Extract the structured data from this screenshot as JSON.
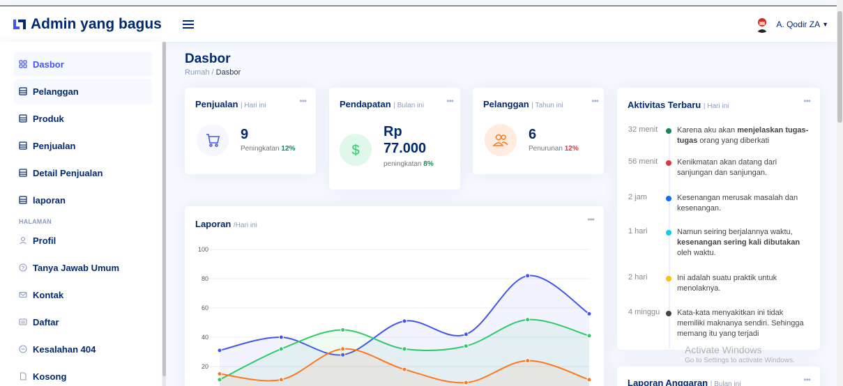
{
  "brand": {
    "title": "Admin yang bagus"
  },
  "user": {
    "name": "A. Qodir ZA"
  },
  "sidebar": {
    "items": [
      {
        "label": "Dasbor",
        "icon": "grid-icon"
      },
      {
        "label": "Pelanggan",
        "icon": "layout-icon"
      },
      {
        "label": "Produk",
        "icon": "layout-icon"
      },
      {
        "label": "Penjualan",
        "icon": "layout-icon"
      },
      {
        "label": "Detail Penjualan",
        "icon": "layout-icon"
      },
      {
        "label": "laporan",
        "icon": "layout-icon"
      }
    ],
    "heading": "HALAMAN",
    "pages": [
      {
        "label": "Profil",
        "icon": "person-icon"
      },
      {
        "label": "Tanya Jawab Umum",
        "icon": "question-circle-icon"
      },
      {
        "label": "Kontak",
        "icon": "envelope-icon"
      },
      {
        "label": "Daftar",
        "icon": "card-list-icon"
      },
      {
        "label": "Kesalahan 404",
        "icon": "dash-circle-icon"
      },
      {
        "label": "Kosong",
        "icon": "file-icon"
      }
    ]
  },
  "page": {
    "title": "Dasbor",
    "breadcrumb": [
      "Rumah",
      "Dasbor"
    ]
  },
  "cards": {
    "sales": {
      "title": "Penjualan",
      "filter": "| Hari ini",
      "value": "9",
      "pct": "12%",
      "note": "Peningkatan",
      "icon": "cart-icon"
    },
    "revenue": {
      "title": "Pendapatan",
      "filter": "| Bulan ini",
      "value_line1": "Rp",
      "value_line2": "77.000",
      "pct": "8%",
      "note": "peningkatan",
      "icon": "dollar-icon"
    },
    "customers": {
      "title": "Pelanggan",
      "filter": "| Tahun ini",
      "value": "6",
      "pct": "12%",
      "note": "Penurunan",
      "icon": "people-icon"
    }
  },
  "report": {
    "title": "Laporan",
    "filter": "/Hari ini"
  },
  "chart_data": {
    "type": "area",
    "title": "Laporan",
    "ylim": [
      0,
      100
    ],
    "y_ticks": [
      20,
      40,
      60,
      80,
      100
    ],
    "grid": true,
    "series": [
      {
        "color": "#4154f1",
        "values": [
          31,
          40,
          28,
          51,
          42,
          82,
          56
        ]
      },
      {
        "color": "#2eca6a",
        "values": [
          11,
          32,
          45,
          32,
          34,
          52,
          41
        ]
      },
      {
        "color": "#ff771d",
        "values": [
          15,
          11,
          32,
          18,
          9,
          24,
          11
        ]
      }
    ]
  },
  "activity": {
    "title": "Aktivitas Terbaru",
    "filter": "| Hari ini",
    "items": [
      {
        "time": "32 menit",
        "color": "#198754",
        "pre": "Karena aku akan ",
        "bold": "menjelaskan tugas-tugas",
        "post": " orang yang diberkati"
      },
      {
        "time": "56 menit",
        "color": "#dc3545",
        "pre": "Kenikmatan akan datang dari sanjungan dan sanjungan.",
        "bold": "",
        "post": ""
      },
      {
        "time": "2 jam",
        "color": "#0d6efd",
        "pre": "Kesenangan merusak masalah dan kesenangan.",
        "bold": "",
        "post": ""
      },
      {
        "time": "1 hari",
        "color": "#0dcaf0",
        "pre": "Namun seiring berjalannya waktu, ",
        "bold": "kesenangan sering kali dibutakan",
        "post": " oleh waktu."
      },
      {
        "time": "2 hari",
        "color": "#ffc107",
        "pre": "Ini adalah suatu praktik untuk menolaknya.",
        "bold": "",
        "post": ""
      },
      {
        "time": "4 minggu",
        "color": "#444444",
        "pre": "Kata-kata menyakitkan ini tidak memiliki maknanya sendiri. Sehingga memang itu yang terjadi",
        "bold": "",
        "post": ""
      }
    ]
  },
  "budget": {
    "title": "Laporan Anggaran",
    "filter": "| Bulan ini"
  },
  "watermark": {
    "line1": "Activate Windows",
    "line2": "Go to Settings to activate Windows."
  },
  "colors": {
    "primary": "#4154f1",
    "navy": "#012970",
    "bg": "#f6f9ff"
  }
}
